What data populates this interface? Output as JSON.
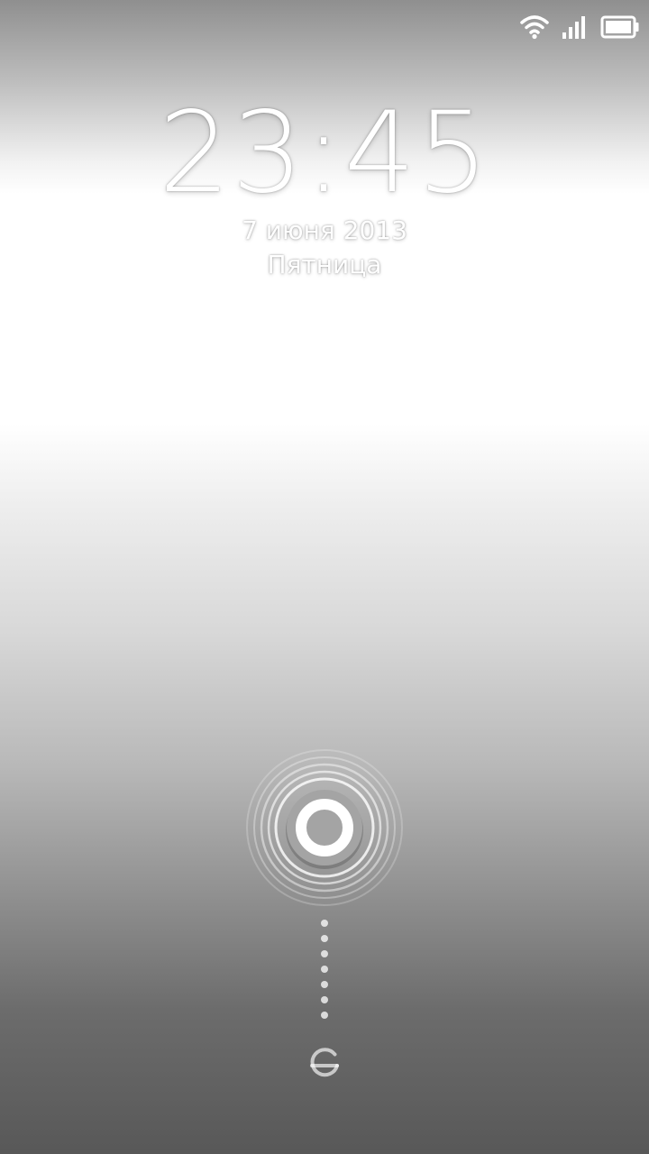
{
  "status_bar": {
    "icons": [
      "wifi-icon",
      "signal-icon",
      "battery-icon"
    ]
  },
  "lockscreen": {
    "time": "23:45",
    "date": "7 июня 2013",
    "weekday": "Пятница"
  },
  "unlock": {
    "handle_icon": "unlock-ring-icon",
    "target_icon": "unlock-target-icon"
  }
}
